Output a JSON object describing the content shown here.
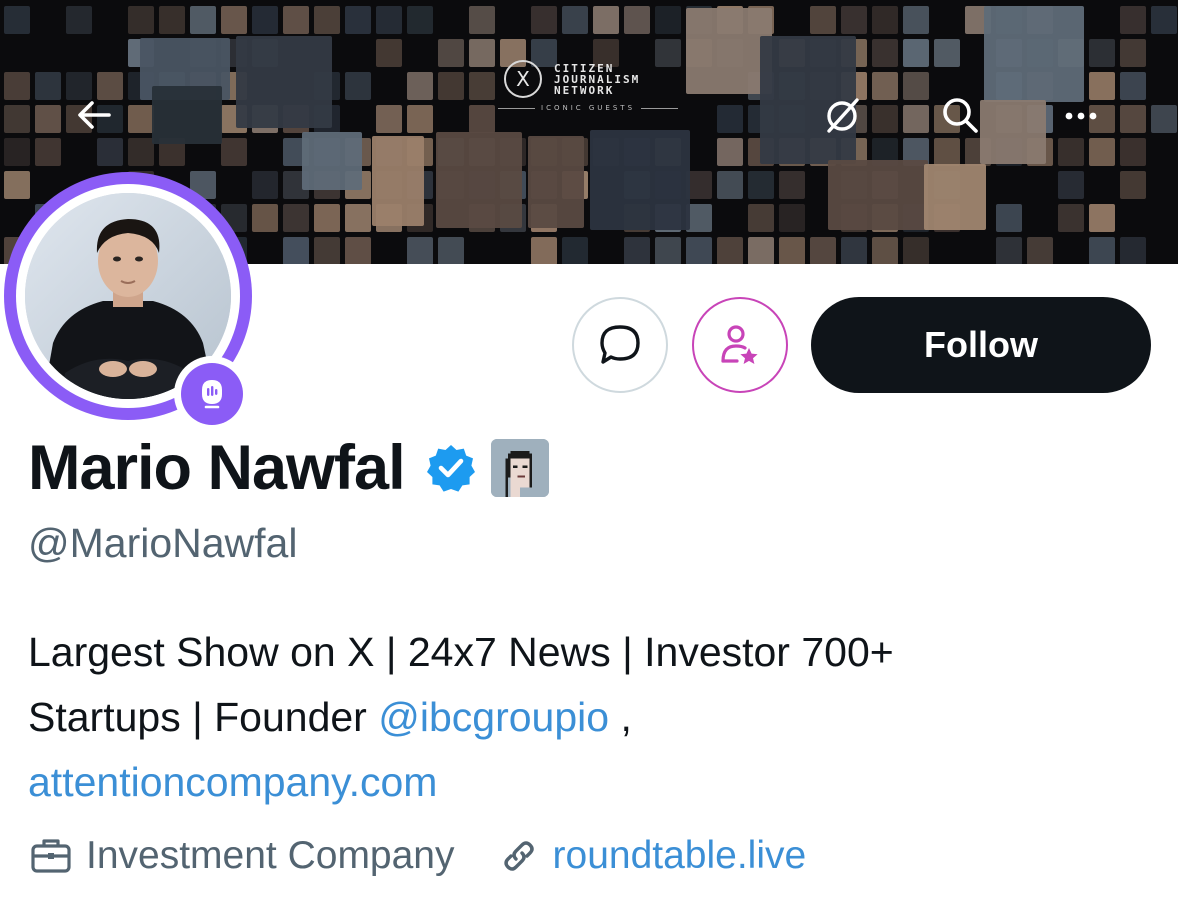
{
  "banner": {
    "network_logo": {
      "mark": "X",
      "title_lines": [
        "CITIZEN",
        "JOURNALISM",
        "NETWORK"
      ],
      "subtitle": "ICONIC GUESTS"
    },
    "buttons": {
      "back_icon": "arrow-left-icon",
      "grok_icon": "slashed-circle-icon",
      "search_icon": "search-icon",
      "more_icon": "more-icon"
    }
  },
  "profile": {
    "display_name": "Mario Nawfal",
    "handle": "@MarioNawfal",
    "verified_icon": "verified-badge-icon",
    "affiliate_icon": "pixel-avatar-icon",
    "bio_parts": {
      "line1": "Largest Show on X | 24x7 News | Investor 700+",
      "line2_prefix": "Startups | Founder ",
      "mention": "@ibcgroupio",
      "line2_suffix": " ,",
      "website_in_bio": "attentioncompany.com"
    },
    "category": "Investment Company",
    "website": "roundtable.live"
  },
  "actions": {
    "follow_label": "Follow",
    "message_icon": "message-bubble-icon",
    "subscribe_icon": "person-star-icon"
  },
  "colors": {
    "accent_purple": "#8b5cf6",
    "subscribe_border": "#c844b8",
    "link_blue": "#3b8fd6",
    "verified_blue": "#1d9bf0",
    "follow_bg": "#0f1419",
    "secondary_text": "#536471"
  }
}
